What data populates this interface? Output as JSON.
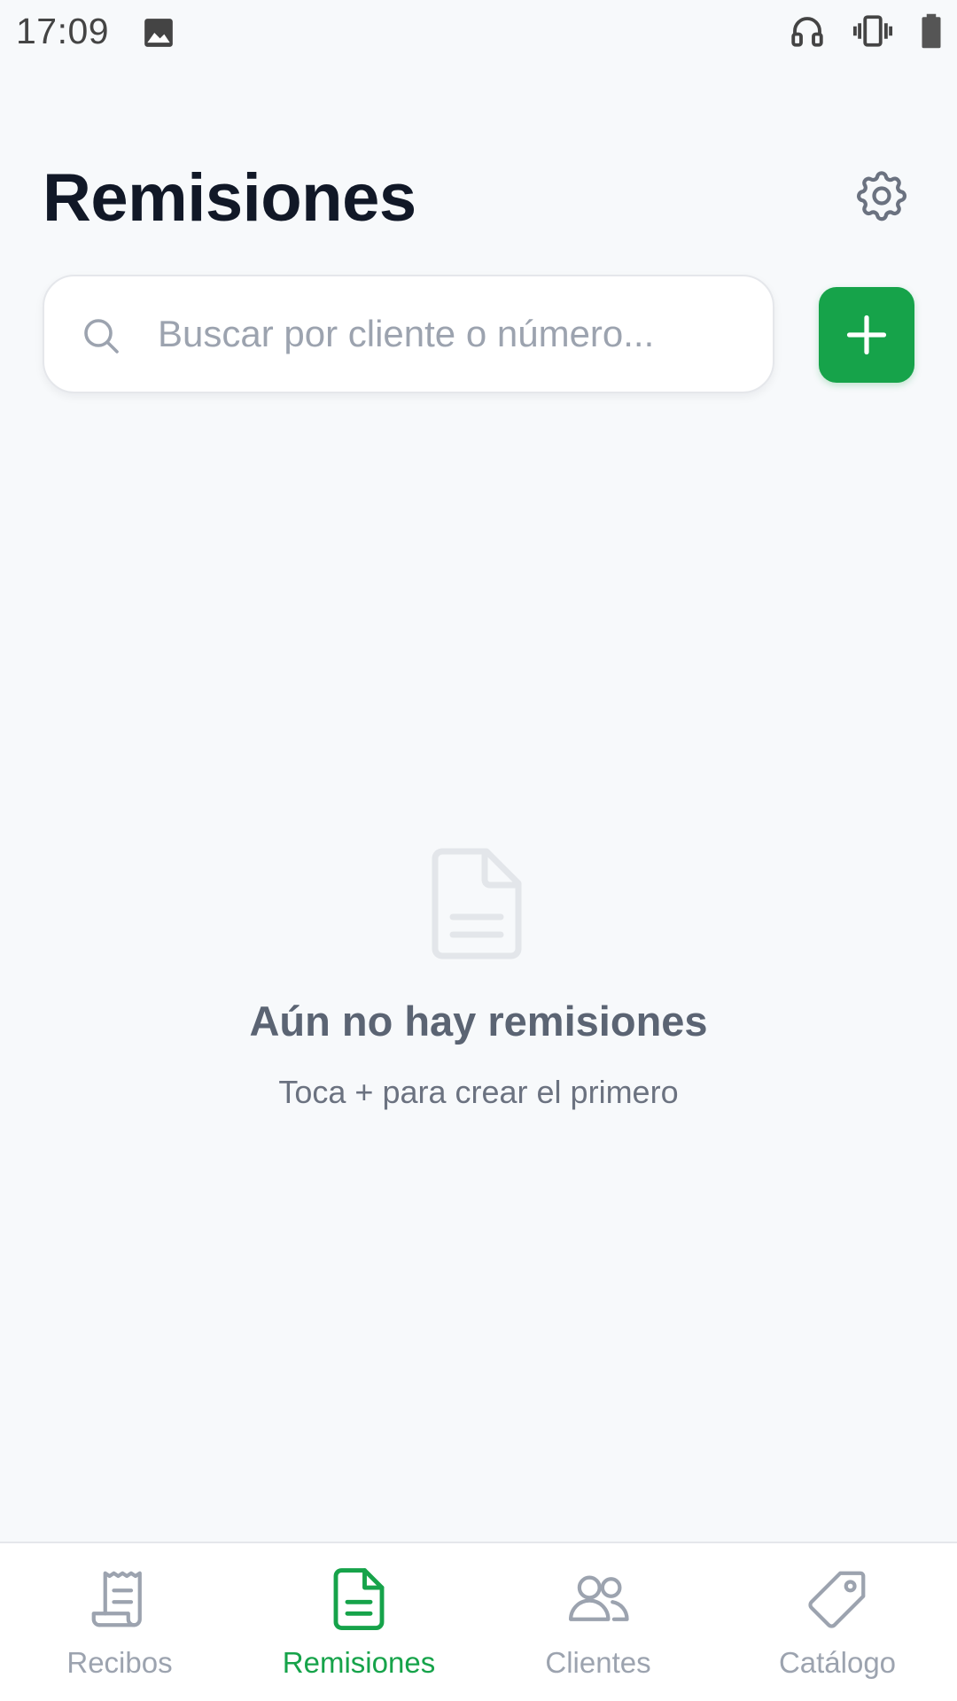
{
  "status_bar": {
    "time": "17:09",
    "icons": [
      "gallery-icon",
      "headphones-icon",
      "vibrate-icon",
      "battery-icon"
    ]
  },
  "header": {
    "title": "Remisiones",
    "settings_icon": "gear-icon"
  },
  "search": {
    "placeholder": "Buscar por cliente o número...",
    "value": ""
  },
  "add_button": {
    "icon": "plus-icon"
  },
  "empty_state": {
    "icon": "document-icon",
    "title": "Aún no hay remisiones",
    "subtitle": "Toca + para crear el primero"
  },
  "bottom_nav": {
    "items": [
      {
        "label": "Recibos",
        "icon": "receipt-icon",
        "active": false
      },
      {
        "label": "Remisiones",
        "icon": "document-icon",
        "active": true
      },
      {
        "label": "Clientes",
        "icon": "users-icon",
        "active": false
      },
      {
        "label": "Catálogo",
        "icon": "tag-icon",
        "active": false
      }
    ]
  },
  "colors": {
    "background": "#f7f9fb",
    "accent": "#16a34a",
    "title": "#111827",
    "muted": "#9ca3af"
  }
}
